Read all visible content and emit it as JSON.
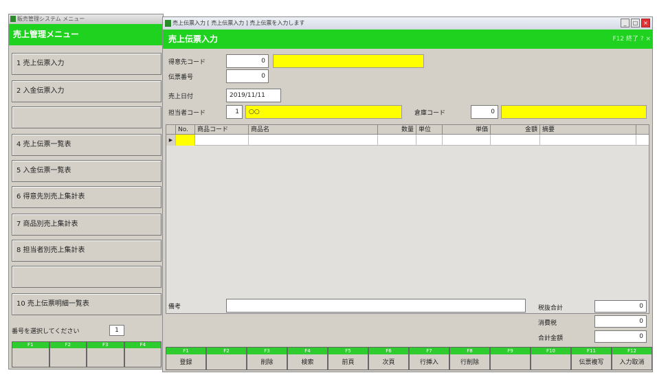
{
  "menu_window": {
    "titlebar": "販売管理システム  メニュー",
    "header": "売上管理メニュー",
    "items": [
      "1 売上伝票入力",
      "2 入金伝票入力",
      "",
      "4 売上伝票一覧表",
      "5 入金伝票一覧表",
      "6 得意先別売上集計表",
      "7 商品別売上集計表",
      "8 担当者別売上集計表",
      "",
      "10 売上伝票明細一覧表"
    ],
    "prompt": "番号を選択してください",
    "select_value": "1",
    "fkeys": [
      "F1",
      "F2",
      "F3",
      "F4"
    ]
  },
  "entry_window": {
    "titlebar": "売上伝票入力 [ 売上伝票入力 ]  売上伝票を入力します",
    "header": "売上伝票入力",
    "header_right": "F12 終了  ?  ×",
    "controls": {
      "min": "_",
      "max": "□",
      "close": "×"
    },
    "fields": {
      "tokuisaki_label": "得意先コード",
      "tokuisaki_value": "0",
      "denpyo_label": "伝票番号",
      "denpyo_value": "0",
      "date_label": "売上日付",
      "date_value": "2019/11/11",
      "tanto_label": "担当者コード",
      "tanto_value": "1",
      "tanto_name": "○○",
      "souko_label": "倉庫コード",
      "souko_value": "0"
    },
    "grid": {
      "headers": [
        "No.",
        "商品コード",
        "商品名",
        "数量",
        "単位",
        "単価",
        "金額",
        "摘要"
      ],
      "row_marker": "▶"
    },
    "bikou_label": "備考",
    "totals": [
      {
        "label": "税抜合計",
        "value": "0"
      },
      {
        "label": "消費税",
        "value": "0"
      },
      {
        "label": "合計金額",
        "value": "0"
      }
    ],
    "fkeys": [
      {
        "key": "F1",
        "label": "登録"
      },
      {
        "key": "F2",
        "label": ""
      },
      {
        "key": "F3",
        "label": "削除"
      },
      {
        "key": "F4",
        "label": "検索"
      },
      {
        "key": "F5",
        "label": "前頁"
      },
      {
        "key": "F6",
        "label": "次頁"
      },
      {
        "key": "F7",
        "label": "行挿入"
      },
      {
        "key": "F8",
        "label": "行削除"
      },
      {
        "key": "F9",
        "label": ""
      },
      {
        "key": "F10",
        "label": ""
      },
      {
        "key": "F11",
        "label": "伝票複写"
      },
      {
        "key": "F12",
        "label": "入力取消"
      }
    ]
  }
}
